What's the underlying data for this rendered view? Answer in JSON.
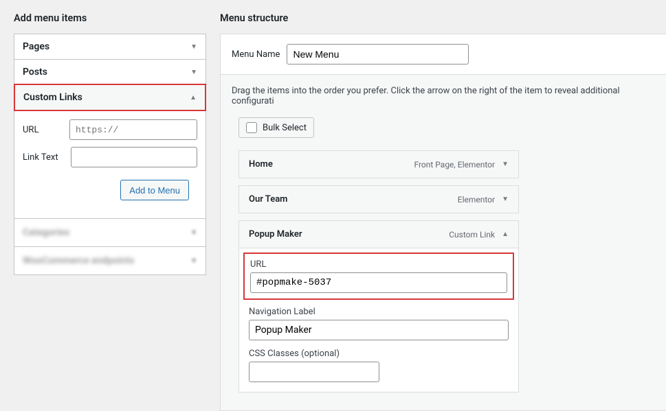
{
  "left": {
    "heading": "Add menu items",
    "panels": {
      "pages": {
        "label": "Pages"
      },
      "posts": {
        "label": "Posts"
      },
      "custom_links": {
        "label": "Custom Links",
        "url_label": "URL",
        "url_placeholder": "https://",
        "link_text_label": "Link Text",
        "add_button": "Add to Menu"
      },
      "blurred1": {
        "label": "Categories"
      },
      "blurred2": {
        "label": "WooCommerce endpoints"
      }
    }
  },
  "right": {
    "heading": "Menu structure",
    "menu_name_label": "Menu Name",
    "menu_name_value": "New Menu",
    "instruction": "Drag the items into the order you prefer. Click the arrow on the right of the item to reveal additional configurati",
    "bulk_select": "Bulk Select",
    "items": [
      {
        "title": "Home",
        "type": "Front Page, Elementor",
        "expanded": false
      },
      {
        "title": "Our Team",
        "type": "Elementor",
        "expanded": false
      },
      {
        "title": "Popup Maker",
        "type": "Custom Link",
        "expanded": true,
        "url_label": "URL",
        "url_value": "#popmake-5037",
        "nav_label": "Navigation Label",
        "nav_value": "Popup Maker",
        "css_label": "CSS Classes (optional)",
        "css_value": ""
      }
    ]
  }
}
